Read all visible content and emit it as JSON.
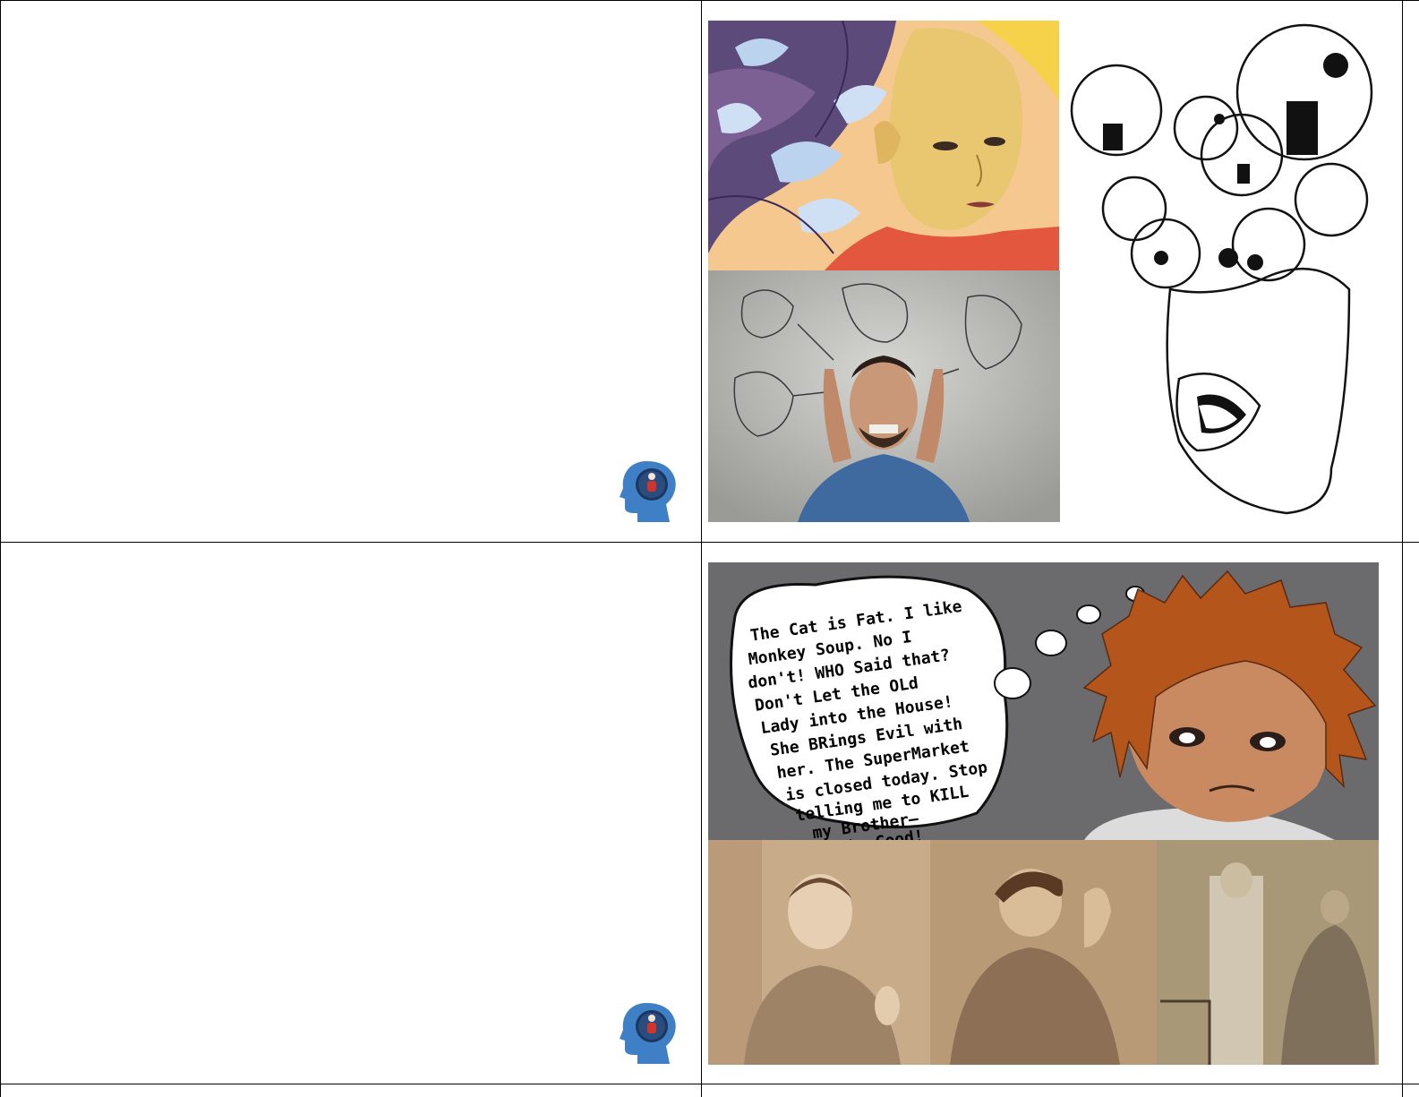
{
  "worksheet": {
    "card1": {
      "text_panel": "",
      "icon": "brain-head-icon",
      "image_collage": [
        "swirling-face-illustration",
        "man-covering-ears-voices-photo",
        "screaming-faces-sketch"
      ]
    },
    "card2": {
      "text_panel": "",
      "icon": "brain-head-icon",
      "comic": {
        "speech_lines": [
          "The Cat is Fat. I like",
          "Monkey Soup. No I",
          "don't! WHO Said that?",
          "Don't Let the OLd",
          "Lady into the House!",
          "She BRings Evil with",
          "her. The SuperMarket",
          "is closed today. Stop",
          "telling me to KILL",
          "my Brother—",
          "He's Good!"
        ]
      },
      "image_collage": [
        "historical-patient-photo-1",
        "historical-patient-photo-2",
        "historical-patient-photo-3"
      ]
    }
  },
  "colors": {
    "border": "#000000",
    "icon_blue": "#3f7fc6",
    "comic_bg": "#6b6a6d",
    "hair": "#b4551c",
    "sepia": "#b89a76"
  }
}
